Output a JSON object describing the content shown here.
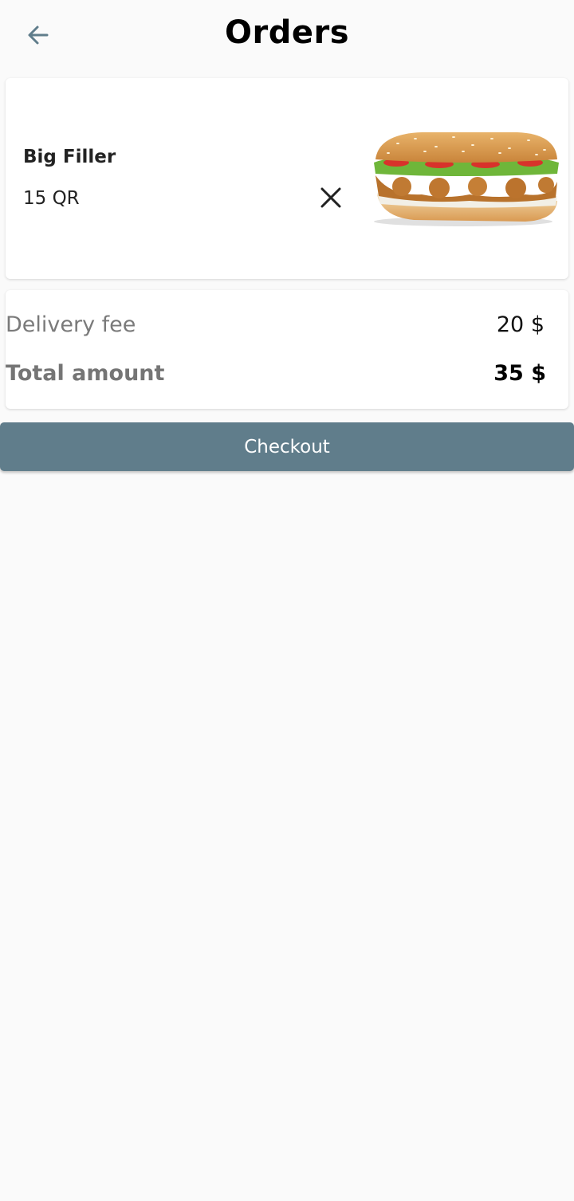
{
  "header": {
    "title": "Orders",
    "back_icon": "arrow-left-icon"
  },
  "order": {
    "items": [
      {
        "name": "Big Filler",
        "price": "15 QR",
        "remove_icon": "close-icon",
        "image": "sandwich-image"
      }
    ]
  },
  "summary": {
    "delivery_fee_label": "Delivery fee",
    "delivery_fee_value": "20 $",
    "total_label": "Total amount",
    "total_value": "35 $"
  },
  "actions": {
    "checkout_label": "Checkout"
  },
  "colors": {
    "background": "#fafafa",
    "accent": "#607d8b",
    "card": "#ffffff"
  }
}
